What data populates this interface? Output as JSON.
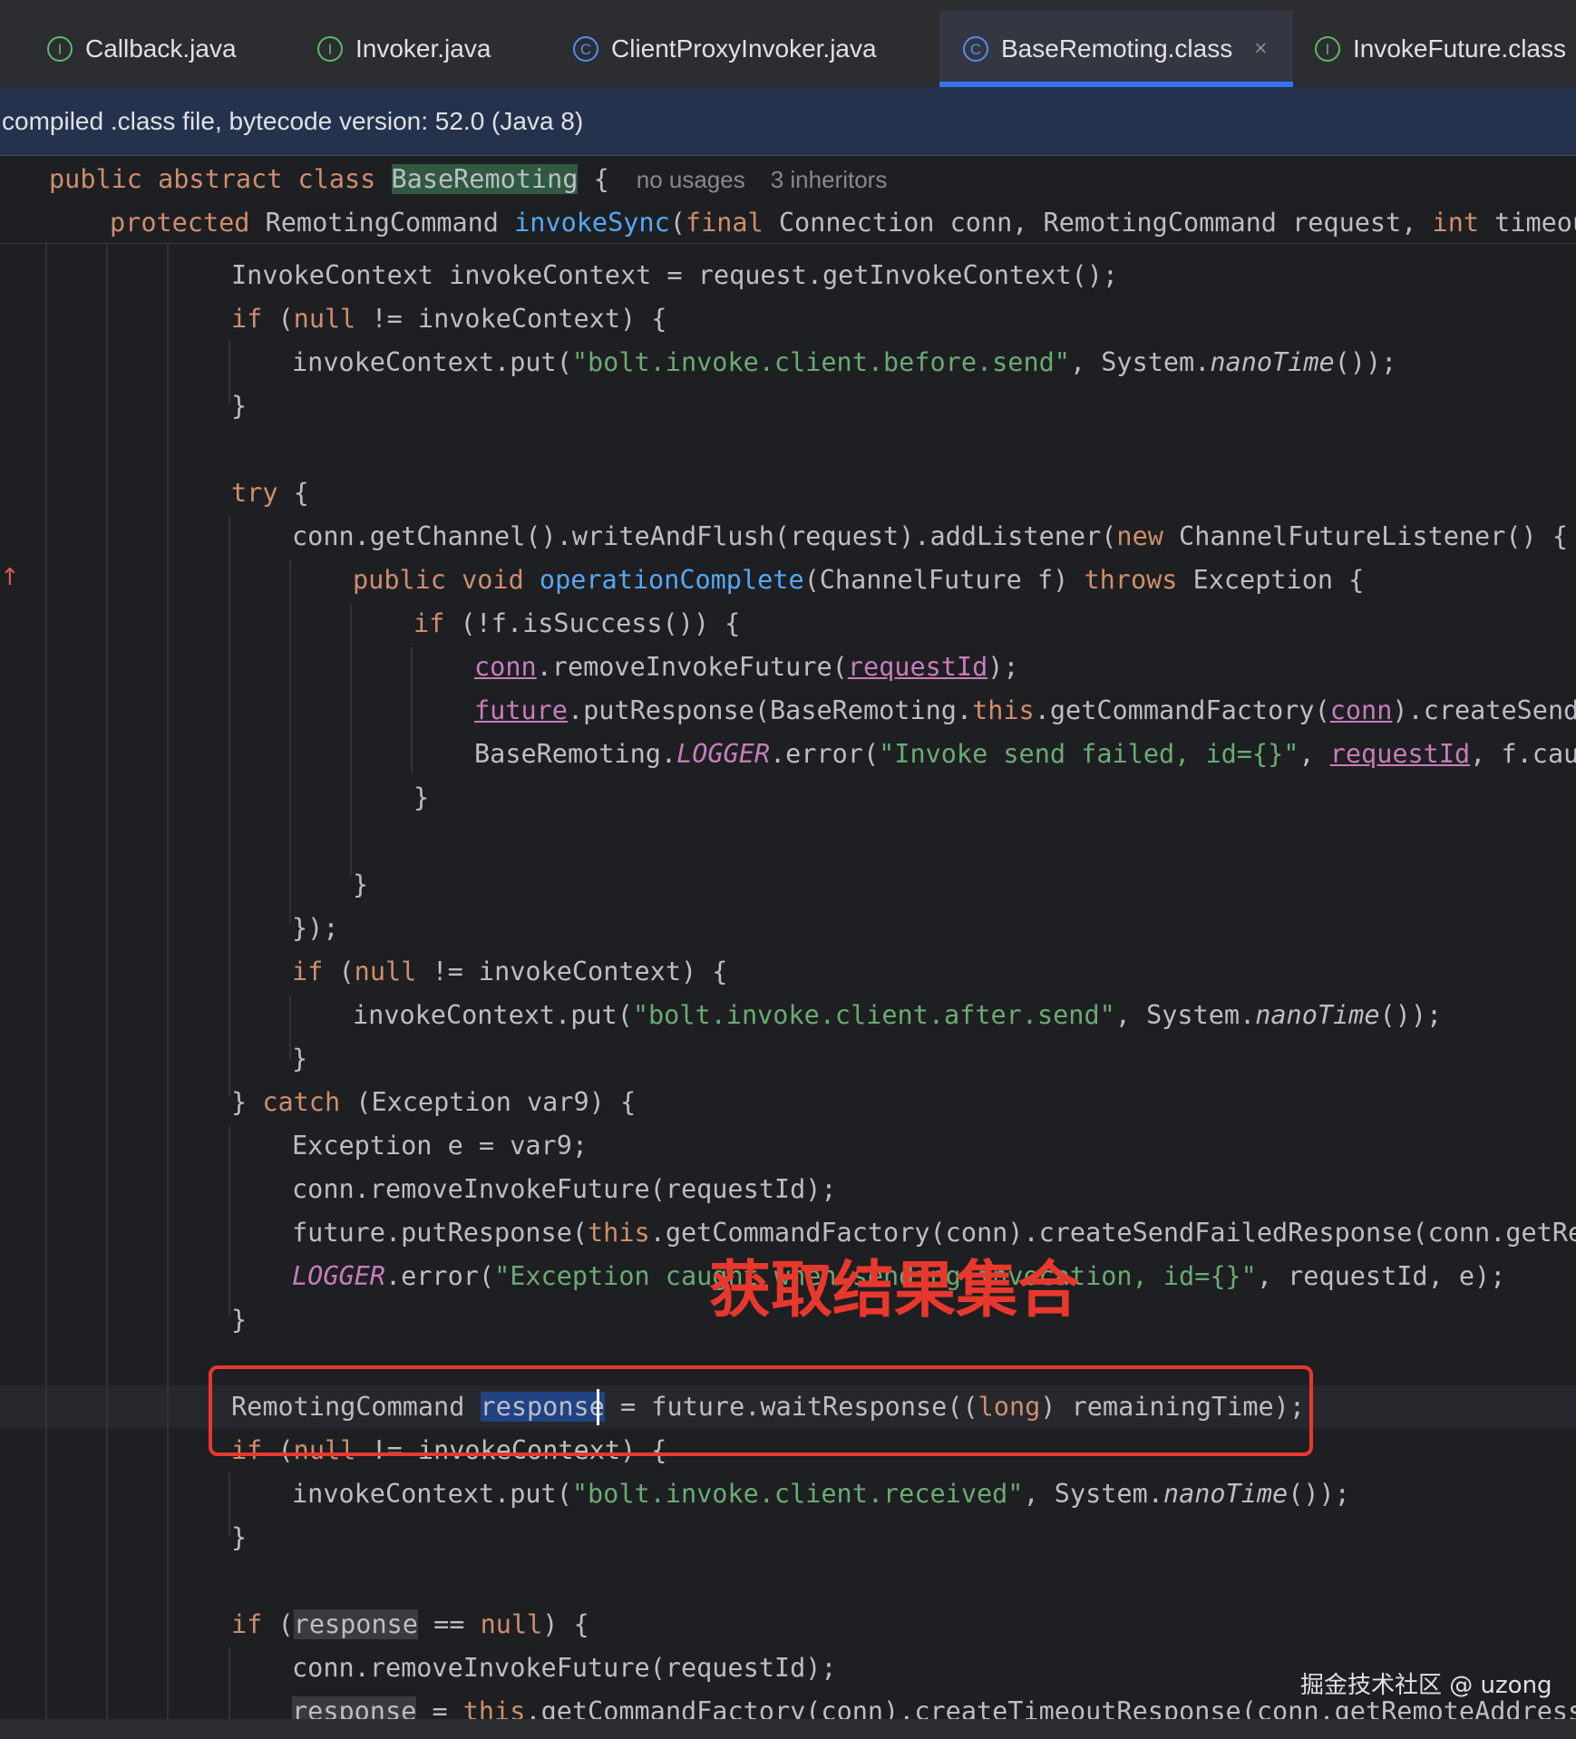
{
  "tabs": [
    {
      "label": "Callback.java",
      "kind": "interface",
      "icon": "I"
    },
    {
      "label": "Invoker.java",
      "kind": "interface",
      "icon": "I"
    },
    {
      "label": "ClientProxyInvoker.java",
      "kind": "class",
      "icon": "C"
    },
    {
      "label": "BaseRemoting.class",
      "kind": "class",
      "icon": "C",
      "active": true,
      "close": "×"
    },
    {
      "label": "InvokeFuture.class",
      "kind": "interface",
      "icon": "I"
    }
  ],
  "banner": "compiled .class file, bytecode version: 52.0 (Java 8)",
  "sticky": {
    "line1": {
      "mod": "public abstract class ",
      "class_name": "BaseRemoting",
      "brace": " {",
      "hint1": "no usages",
      "hint2": "3 inheritors"
    },
    "line2": {
      "mod": "protected ",
      "type": "RemotingCommand ",
      "method": "invokeSync",
      "p1": "(",
      "final": "final",
      "p2": " Connection conn, RemotingCommand request, ",
      "int": "int",
      "p3": " timeoutM"
    }
  },
  "code": {
    "l01": "InvokeContext invokeContext = request.getInvokeContext();",
    "l02a": "if",
    "l02b": " (",
    "l02c": "null",
    "l02d": " != invokeContext) {",
    "l03a": "invokeContext.put(",
    "l03b": "\"bolt.invoke.client.before.send\"",
    "l03c": ", System.",
    "l03d": "nanoTime",
    "l03e": "());",
    "l04": "}",
    "l06a": "try",
    "l06b": " {",
    "l07a": "conn.getChannel().writeAndFlush(request).addListener(",
    "l07b": "new",
    "l07c": " ChannelFutureListener() {",
    "l08a": "public void ",
    "l08b": "operationComplete",
    "l08c": "(ChannelFuture f) ",
    "l08d": "throws",
    "l08e": " Exception {",
    "l09a": "if",
    "l09b": " (!f.isSuccess()) {",
    "l10a": "conn",
    "l10b": ".removeInvokeFuture(",
    "l10c": "requestId",
    "l10d": ");",
    "l11a": "future",
    "l11b": ".putResponse(BaseRemoting.",
    "l11c": "this",
    "l11d": ".getCommandFactory(",
    "l11e": "conn",
    "l11f": ").createSendFa",
    "l12a": "BaseRemoting.",
    "l12b": "LOGGER",
    "l12c": ".error(",
    "l12d": "\"Invoke send failed, id={}\"",
    "l12e": ", ",
    "l12f": "requestId",
    "l12g": ", f.cause",
    "l13": "}",
    "l15": "}",
    "l16": "});",
    "l17a": "if",
    "l17b": " (",
    "l17c": "null",
    "l17d": " != invokeContext) {",
    "l18a": "invokeContext.put(",
    "l18b": "\"bolt.invoke.client.after.send\"",
    "l18c": ", System.",
    "l18d": "nanoTime",
    "l18e": "());",
    "l19": "}",
    "l20a": "} ",
    "l20b": "catch",
    "l20c": " (Exception var9) {",
    "l21": "Exception e = var9;",
    "l22": "conn.removeInvokeFuture(requestId);",
    "l23a": "future.putResponse(",
    "l23b": "this",
    "l23c": ".getCommandFactory(conn).createSendFailedResponse(conn.getReme",
    "l24a": "LOGGER",
    "l24b": ".error(",
    "l24c": "\"Exception caught when sending invocation, id={}\"",
    "l24d": ", requestId, e);",
    "l25": "}",
    "l27a": "RemotingCommand ",
    "l27b": "response",
    "l27c": " = future.waitResponse((",
    "l27d": "long",
    "l27e": ") remainingTime);",
    "l28a": "if",
    "l28b": " (",
    "l28c": "null",
    "l28d": " != invokeContext) {",
    "l29a": "invokeContext.put(",
    "l29b": "\"bolt.invoke.client.received\"",
    "l29c": ", System.",
    "l29d": "nanoTime",
    "l29e": "());",
    "l30": "}",
    "l32a": "if",
    "l32b": " (",
    "l32c": "response",
    "l32d": " == ",
    "l32e": "null",
    "l32f": ") {",
    "l33": "conn.removeInvokeFuture(requestId);",
    "l34a": "response",
    "l34b": " = ",
    "l34c": "this",
    "l34d": ".getCommandFactory(conn).createTimeoutResponse(conn.getRemoteAddress()"
  },
  "annotation": "获取结果集合",
  "watermark": "掘金技术社区 @ uzong",
  "gutter_mark": "↑",
  "colors": {
    "keyword": "#cf8e6d",
    "method_decl": "#56a8f5",
    "string": "#6aab73",
    "static_field": "#c77dbb",
    "annotation_red": "#e8382d",
    "tab_underline": "#3574f0"
  }
}
